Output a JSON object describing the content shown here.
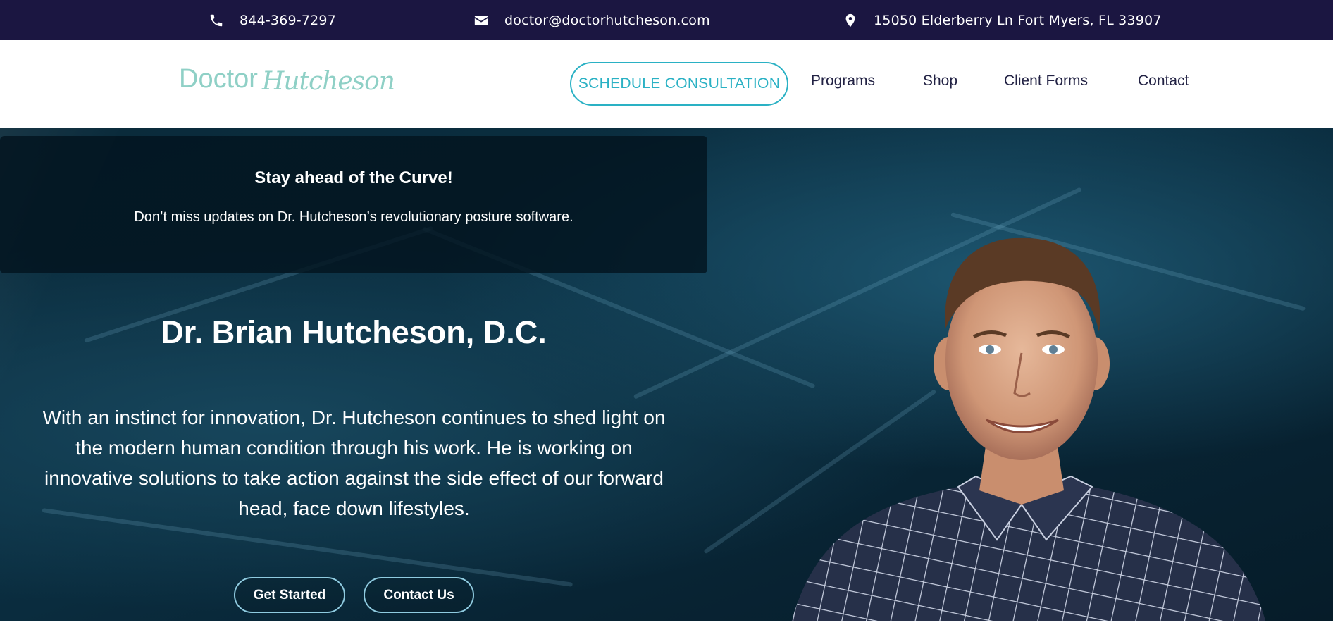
{
  "topbar": {
    "phone": "844-369-7297",
    "email": "doctor@doctorhutcheson.com",
    "address": "15050 Elderberry Ln Fort Myers, FL 33907",
    "icons": [
      "phone-icon",
      "envelope-icon",
      "map-pin-icon"
    ]
  },
  "header": {
    "logo_primary": "Doctor",
    "logo_script": "Hutcheson",
    "cta_label": "SCHEDULE CONSULTATION",
    "nav": {
      "programs": "Programs",
      "shop": "Shop",
      "client_forms": "Client Forms",
      "contact": "Contact"
    }
  },
  "hero": {
    "notice_title": "Stay ahead of the Curve!",
    "notice_text": "Don’t miss updates on Dr. Hutcheson’s revolutionary posture software.",
    "name": "Dr. Brian Hutcheson, D.C.",
    "description": "With an instinct for innovation, Dr. Hutcheson continues to shed light on the modern human condition through his work. He is working on innovative solutions to take action against the side effect of our forward head, face down lifestyles.",
    "buttons": {
      "get_started": "Get Started",
      "contact_us": "Contact Us"
    }
  },
  "colors": {
    "topbar_bg": "#1b1641",
    "accent_teal": "#2ab1c4",
    "logo_mint": "#8fd0c6",
    "hero_bg": "#0b3043"
  }
}
